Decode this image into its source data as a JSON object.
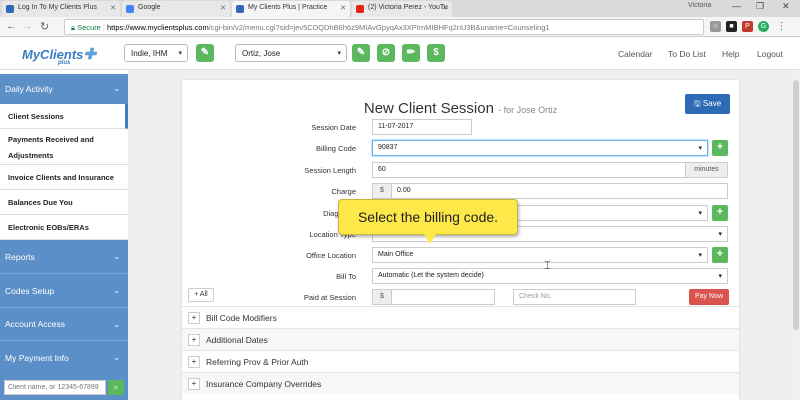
{
  "browser": {
    "tabs": [
      {
        "label": "Log In To My Clients Plus",
        "color": "#2d6bb6"
      },
      {
        "label": "Google",
        "color": "#4285f4"
      },
      {
        "label": "My Clients Plus | Practice",
        "color": "#2d6bb6"
      },
      {
        "label": "(2) Victoria Perez - YouTu",
        "color": "#e62117"
      }
    ],
    "user_chip": "Victoria",
    "secure_label": "Secure",
    "url_host": "https://www.myclientsplus.com",
    "url_path": "/cgi-bin/v2/menu.cgi?sid=jev5CDQDhB6h6z9MIAvGpyqAx3XPImMIBHFq2nU3B&uname=Counseling1"
  },
  "header": {
    "logo": "MyClients",
    "logo_sub": "plus",
    "clinician_select": "Indie, IHM",
    "client_select": "Ortiz, Jose",
    "links": [
      "Calendar",
      "To Do List",
      "Help",
      "Logout"
    ]
  },
  "sidebar": {
    "sections": [
      {
        "label": "Daily Activity",
        "items": [
          "Client Sessions",
          "Payments Received and Adjustments",
          "Invoice Clients and Insurance",
          "Balances Due You",
          "Electronic EOBs/ERAs"
        ]
      },
      {
        "label": "Reports"
      },
      {
        "label": "Codes Setup"
      },
      {
        "label": "Account Access"
      },
      {
        "label": "My Payment Info"
      }
    ],
    "search_placeholder": "Client name, or 12345-67899"
  },
  "form": {
    "title": "New Client Session",
    "subtitle": "- for Jose Ortiz",
    "save_label": "Save",
    "labels": {
      "session_date": "Session Date",
      "billing_code": "Billing Code",
      "session_length": "Session Length",
      "charge": "Charge",
      "diagnosis": "Diagnosis",
      "location_type": "Location Type",
      "office_location": "Office Location",
      "bill_to": "Bill To",
      "paid_at_session": "Paid at Session"
    },
    "values": {
      "session_date": "11-07-2017",
      "billing_code": "90837",
      "session_length": "60",
      "session_length_unit": "minutes",
      "charge_prefix": "$",
      "charge": "0.00",
      "office_location": "Main Office",
      "bill_to": "Automatic (Let the system decide)",
      "paid_prefix": "$",
      "check_placeholder": "Check No."
    },
    "all_label": "+ All",
    "pay_now_label": "Pay Now",
    "accordions": [
      "Bill Code Modifiers",
      "Additional Dates",
      "Referring Prov & Prior Auth",
      "Insurance Company Overrides"
    ]
  },
  "tooltip": "Select the billing code.",
  "colors": {
    "accent": "#3d7cc1",
    "sidebar": "#5b8fc7",
    "success": "#5cb85c",
    "danger": "#d9534f",
    "save": "#2d6bb6",
    "callout": "#fde84a"
  }
}
